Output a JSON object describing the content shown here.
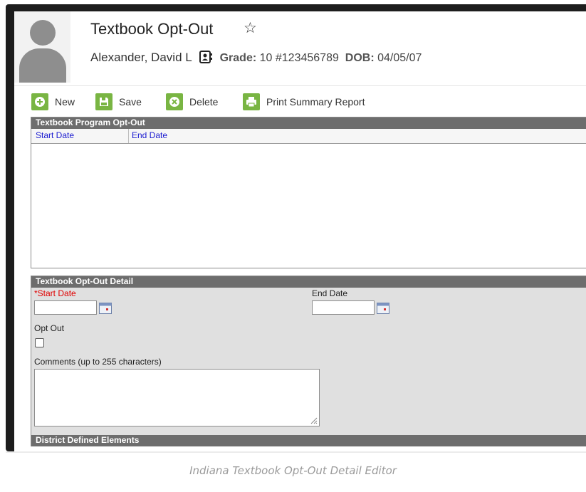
{
  "header": {
    "title": "Textbook Opt-Out",
    "student_name": "Alexander, David L",
    "grade_label": "Grade:",
    "grade_value": "10 #123456789",
    "dob_label": "DOB:",
    "dob_value": "04/05/07"
  },
  "toolbar": {
    "new_label": "New",
    "save_label": "Save",
    "delete_label": "Delete",
    "print_label": "Print Summary Report"
  },
  "grid": {
    "title": "Textbook Program Opt-Out",
    "columns": [
      "Start Date",
      "End Date"
    ]
  },
  "detail": {
    "title": "Textbook Opt-Out Detail",
    "required_mark": "*",
    "start_date_label": "Start Date",
    "start_date_value": "",
    "end_date_label": "End Date",
    "end_date_value": "",
    "opt_out_label": "Opt Out",
    "comments_label": "Comments (up to 255 characters)",
    "comments_value": ""
  },
  "district": {
    "title": "District Defined Elements"
  },
  "caption": "Indiana Textbook Opt-Out Detail Editor",
  "colors": {
    "accent_green": "#79b543",
    "panel_header": "#6d6d6d",
    "required_red": "#e00000",
    "link_blue": "#1c1cd0"
  }
}
